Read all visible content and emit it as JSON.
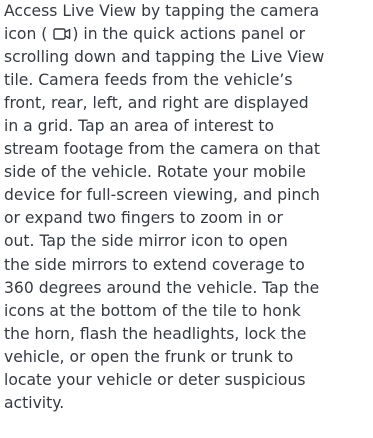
{
  "paragraph": {
    "line_1": "Access Live View by tapping the camera",
    "line_2_before_icon": "icon (",
    "line_2_after_icon": ") in the quick actions panel or",
    "line_3": "scrolling down and tapping the Live View",
    "line_4": "tile. Camera feeds from the vehicle’s",
    "line_5": "front, rear, left, and right are displayed",
    "line_6": "in a grid. Tap an area of interest to",
    "line_7": "stream footage from the camera on that",
    "line_8": "side of the vehicle. Rotate your mobile",
    "line_9": "device for full-screen viewing, and pinch",
    "line_10": "or expand two fingers to zoom in or",
    "line_11": "out. Tap the side mirror icon to open",
    "line_12": "the side mirrors to extend coverage to",
    "line_13": "360 degrees around the vehicle. Tap the",
    "line_14": "icons at the bottom of the tile to honk",
    "line_15": "the horn, flash the headlights, lock the",
    "line_16": "vehicle, or open the frunk or trunk to",
    "line_17": "locate your vehicle or deter suspicious",
    "line_18": "activity."
  },
  "icons": {
    "inline_icon": "camera-icon"
  },
  "colors": {
    "text": "#353a41",
    "background": "#ffffff"
  }
}
